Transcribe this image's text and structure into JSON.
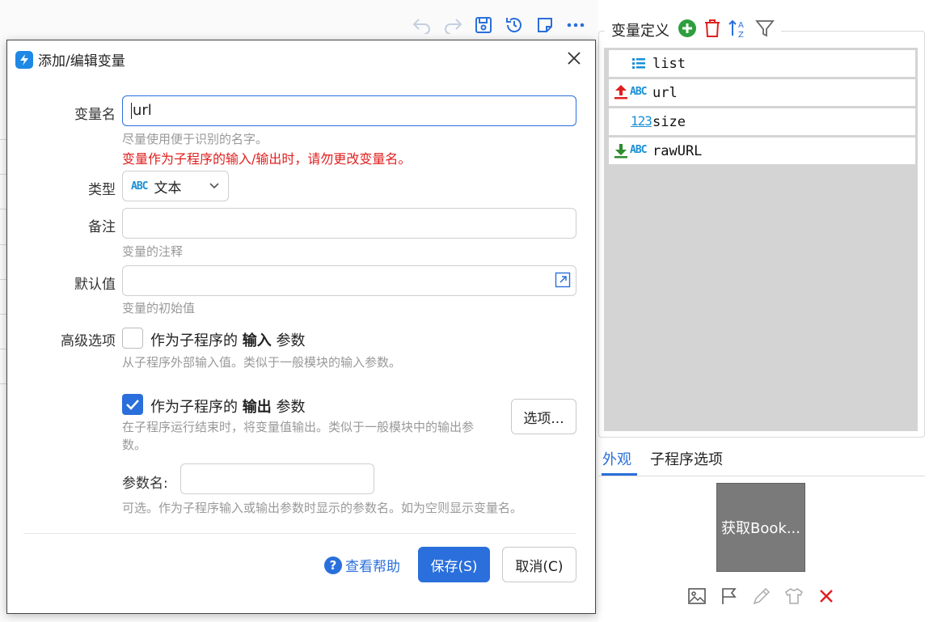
{
  "toolbar": {
    "icons": [
      "undo-icon",
      "redo-icon",
      "save-icon",
      "history-icon",
      "note-icon",
      "more-icon"
    ]
  },
  "variables": {
    "title": "变量定义",
    "rows": [
      {
        "name": "list",
        "type_icon": "list-icon"
      },
      {
        "name": "url",
        "type_icon": "abc-icon",
        "badge": "output-arrow-up",
        "type_text": "ABC"
      },
      {
        "name": "size",
        "type_icon": "number-icon",
        "type_text": "123"
      },
      {
        "name": "rawURL",
        "type_icon": "abc-icon",
        "badge": "input-arrow-down",
        "type_text": "ABC"
      }
    ]
  },
  "tabs": [
    {
      "label": "外观",
      "active": true
    },
    {
      "label": "子程序选项",
      "active": false
    }
  ],
  "thumbnail": {
    "label": "获取Book..."
  },
  "dialog": {
    "title": "添加/编辑变量",
    "name_label": "变量名",
    "name_value": "url",
    "name_hint": "尽量使用便于识别的名字。",
    "name_warning": "变量作为子程序的输入/输出时，请勿更改变量名。",
    "type_label": "类型",
    "type_icon_text": "ABC",
    "type_value": "文本",
    "note_label": "备注",
    "note_value": "",
    "note_hint": "变量的注释",
    "default_label": "默认值",
    "default_value": "",
    "default_hint": "变量的初始值",
    "advanced_label": "高级选项",
    "input_param": {
      "prefix": "作为子程序的",
      "bold": "输入",
      "suffix": "参数",
      "checked": false,
      "hint": "从子程序外部输入值。类似于一般模块的输入参数。"
    },
    "output_param": {
      "prefix": "作为子程序的",
      "bold": "输出",
      "suffix": "参数",
      "checked": true,
      "hint_line1": "在子程序运行结束时，将变量值输出。类似于一般模块中的输出参",
      "hint_line2": "数。"
    },
    "options_button": "选项...",
    "param_name_label": "参数名:",
    "param_name_value": "",
    "param_name_hint": "可选。作为子程序输入或输出参数时显示的参数名。如为空则显示变量名。",
    "help_label": "查看帮助",
    "save_label": "保存(S)",
    "cancel_label": "取消(C)"
  },
  "colors": {
    "accent": "#2a6fdb",
    "warning": "#e02020",
    "add_green": "#2e9e3e",
    "delete_red": "#e02020"
  }
}
